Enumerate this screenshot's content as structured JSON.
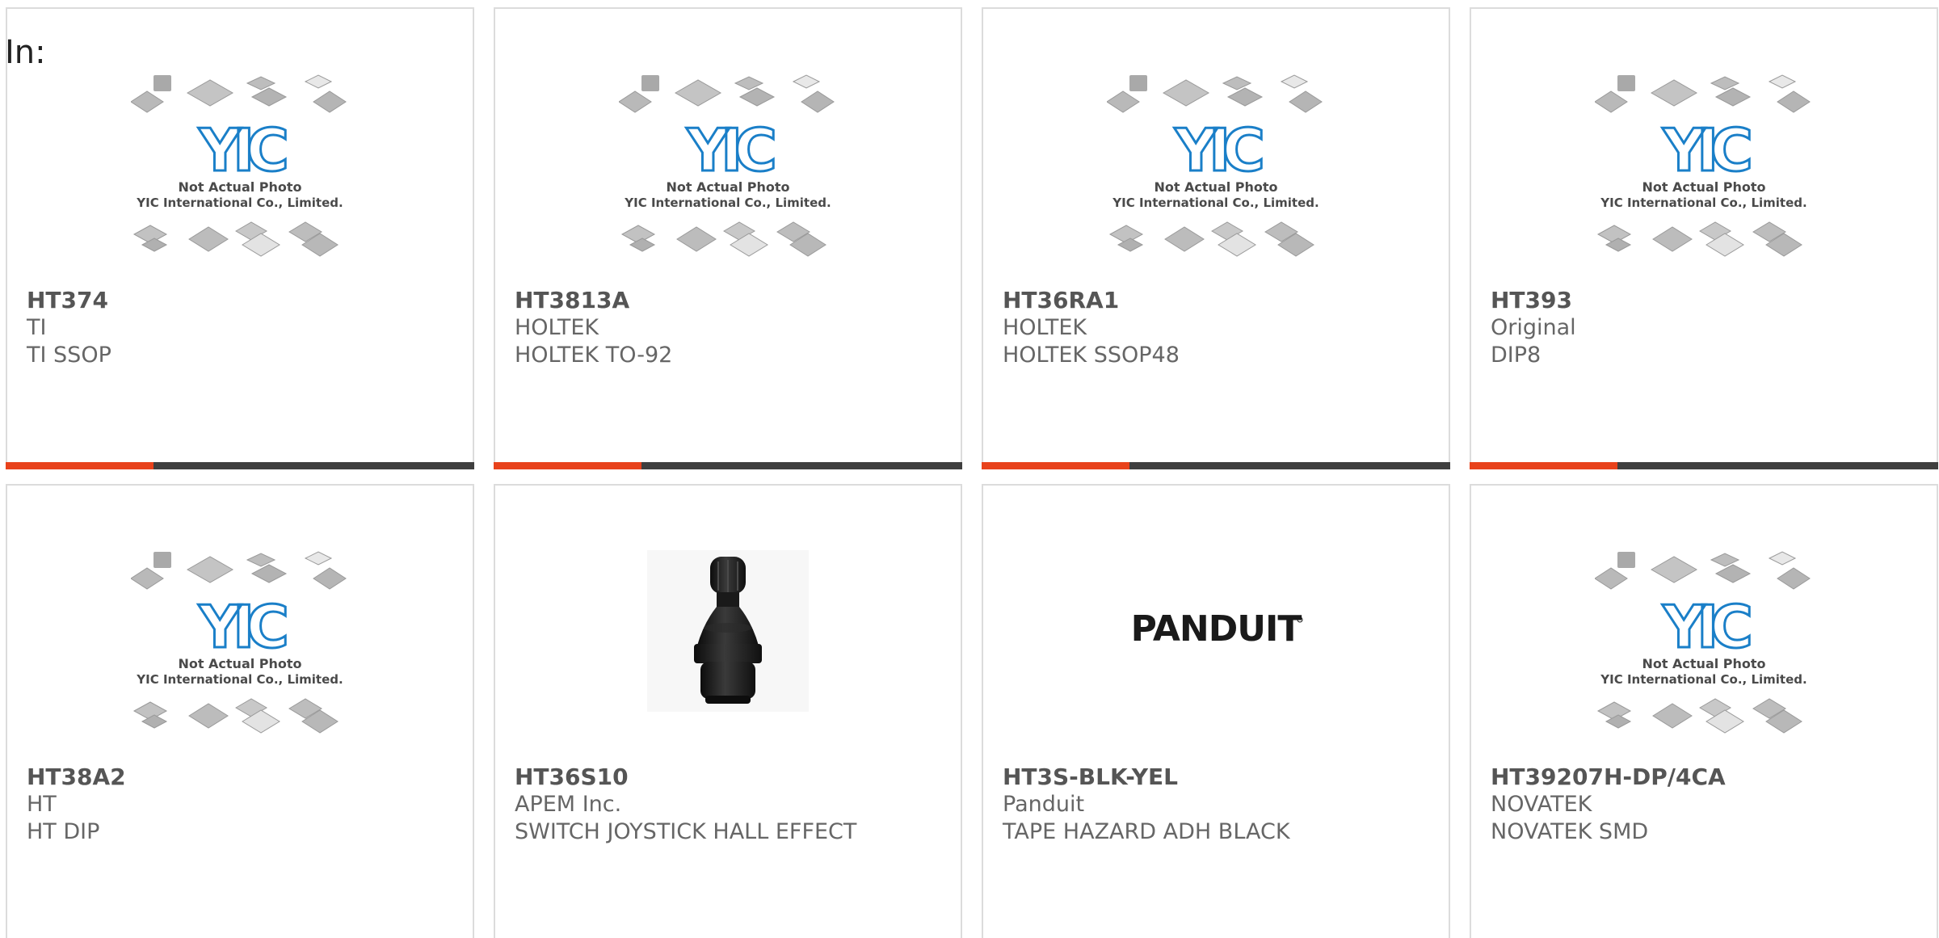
{
  "heading": "In:",
  "placeholder": {
    "line1": "Not Actual Photo",
    "line2": "YIC International Co., Limited."
  },
  "colors": {
    "accent_orange": "#e8421b",
    "bar_dark": "#3f3f3f",
    "yic_blue": "#1a7fc8",
    "border": "#dcdcdc"
  },
  "products": [
    {
      "part": "HT374",
      "maker": "TI",
      "desc": "TI SSOP",
      "image": "yic-placeholder"
    },
    {
      "part": "HT3813A",
      "maker": "HOLTEK",
      "desc": "HOLTEK TO-92",
      "image": "yic-placeholder"
    },
    {
      "part": "HT36RA1",
      "maker": "HOLTEK",
      "desc": "HOLTEK SSOP48",
      "image": "yic-placeholder"
    },
    {
      "part": "HT393",
      "maker": "Original",
      "desc": "DIP8",
      "image": "yic-placeholder"
    },
    {
      "part": "HT38A2",
      "maker": "HT",
      "desc": "HT DIP",
      "image": "yic-placeholder"
    },
    {
      "part": "HT36S10",
      "maker": "APEM Inc.",
      "desc": "SWITCH JOYSTICK HALL EFFECT",
      "image": "joystick-photo"
    },
    {
      "part": "HT3S-BLK-YEL",
      "maker": "Panduit",
      "desc": "TAPE HAZARD ADH BLACK",
      "image": "panduit-logo",
      "logo_text": "PANDUIT"
    },
    {
      "part": "HT39207H-DP/4CA",
      "maker": "NOVATEK",
      "desc": "NOVATEK SMD",
      "image": "yic-placeholder"
    }
  ]
}
